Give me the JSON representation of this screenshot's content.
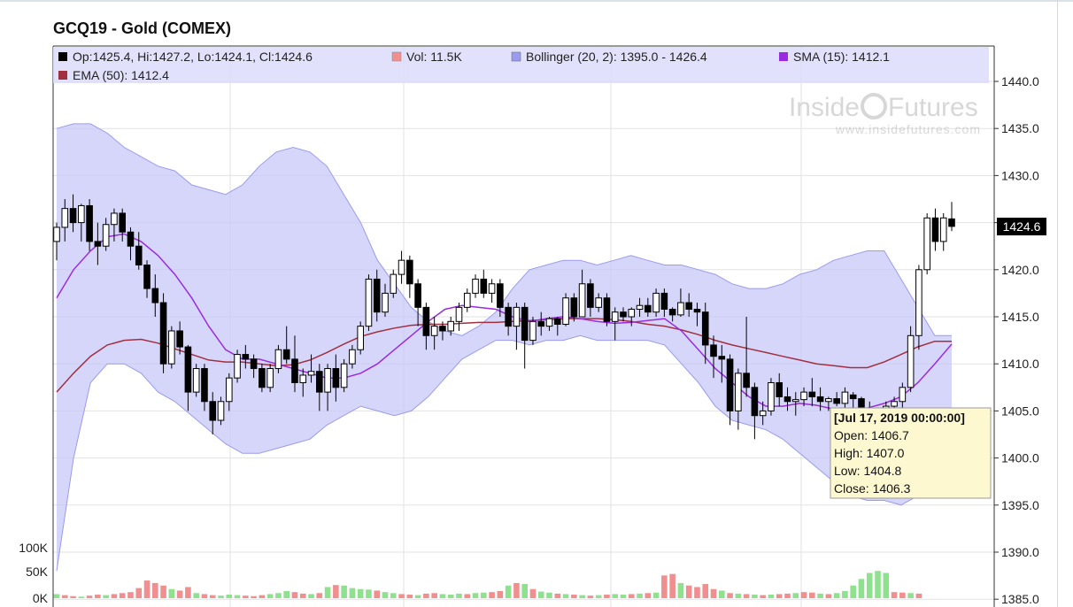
{
  "title": "GCQ19 - Gold (COMEX)",
  "legend": {
    "ohlc": "Op:1425.4, Hi:1427.2, Lo:1424.1, Cl:1424.6",
    "vol": "Vol: 11.5K",
    "bollinger": "Bollinger (20, 2): 1395.0 - 1426.4",
    "sma": "SMA (15): 1412.1",
    "ema": "EMA (50): 1412.4"
  },
  "watermark": {
    "brand_left": "Inside",
    "brand_right": "Futures",
    "url": "www.insidefutures.com"
  },
  "last_price_label": "1424.6",
  "tooltip": {
    "date": "[Jul 17, 2019 00:00:00]",
    "open": "Open: 1406.7",
    "high": "High: 1407.0",
    "low": "Low: 1404.8",
    "close": "Close: 1406.3"
  },
  "volume_axis": [
    "100K",
    "50K",
    "0K"
  ],
  "colors": {
    "up_volume": "#8fe08f",
    "down_volume": "#f08f8f",
    "bollinger_fill": "#c8c8f8",
    "bollinger_line": "#9a9af0",
    "sma": "#9a2be0",
    "ema": "#a03040",
    "candle_outline": "#000000"
  },
  "chart_data": {
    "type": "candlestick",
    "y_axis": {
      "ticks": [
        1385,
        1390,
        1395,
        1400,
        1405,
        1410,
        1415,
        1420,
        1425,
        1430,
        1435,
        1440
      ],
      "ylim": [
        1385,
        1441
      ],
      "position": "right"
    },
    "grid": true,
    "candles": [
      [
        1423,
        1425,
        1421,
        1424.5
      ],
      [
        1424.5,
        1427.5,
        1423,
        1426.5
      ],
      [
        1426.5,
        1428,
        1424,
        1425
      ],
      [
        1425,
        1427,
        1423,
        1426.8
      ],
      [
        1426.8,
        1427.5,
        1422,
        1423
      ],
      [
        1423,
        1425,
        1420.5,
        1422.5
      ],
      [
        1422.5,
        1425.5,
        1422,
        1424.8
      ],
      [
        1424.8,
        1426.5,
        1423,
        1426
      ],
      [
        1426,
        1426.5,
        1423,
        1424
      ],
      [
        1424,
        1424.5,
        1421,
        1422.5
      ],
      [
        1422.5,
        1424,
        1420,
        1420.5
      ],
      [
        1420.5,
        1421,
        1417,
        1418
      ],
      [
        1418,
        1419.5,
        1415,
        1416.5
      ],
      [
        1416.5,
        1417.5,
        1409,
        1410
      ],
      [
        1410,
        1414,
        1409.5,
        1413.5
      ],
      [
        1413.5,
        1414.5,
        1411,
        1411.8
      ],
      [
        1411.8,
        1412,
        1405,
        1407
      ],
      [
        1407,
        1410,
        1406.5,
        1409.5
      ],
      [
        1409.5,
        1410,
        1405,
        1406
      ],
      [
        1406,
        1407,
        1402.5,
        1404
      ],
      [
        1404,
        1406.5,
        1403.5,
        1406
      ],
      [
        1406,
        1409,
        1405,
        1408.5
      ],
      [
        1408.5,
        1411.5,
        1408,
        1411
      ],
      [
        1411,
        1412,
        1409.5,
        1410.5
      ],
      [
        1410.5,
        1411,
        1408.5,
        1409.5
      ],
      [
        1409.5,
        1410,
        1407,
        1407.5
      ],
      [
        1407.5,
        1410,
        1407,
        1409.5
      ],
      [
        1409.5,
        1412,
        1409,
        1411.5
      ],
      [
        1411.5,
        1414,
        1410,
        1410.5
      ],
      [
        1410.5,
        1413,
        1407,
        1408
      ],
      [
        1408,
        1409.5,
        1406.5,
        1408.8
      ],
      [
        1408.8,
        1411,
        1408,
        1409.2
      ],
      [
        1409.2,
        1410,
        1405,
        1407
      ],
      [
        1407,
        1410,
        1405,
        1409.5
      ],
      [
        1409.5,
        1411,
        1406,
        1407.5
      ],
      [
        1407.5,
        1410.5,
        1407,
        1410
      ],
      [
        1410,
        1412,
        1409.5,
        1411.5
      ],
      [
        1411.5,
        1414.5,
        1411,
        1414
      ],
      [
        1414,
        1419.5,
        1413.5,
        1419
      ],
      [
        1419,
        1420,
        1414.5,
        1415.5
      ],
      [
        1415.5,
        1418.5,
        1415,
        1417.5
      ],
      [
        1417.5,
        1420,
        1417,
        1419.5
      ],
      [
        1419.5,
        1422,
        1418.5,
        1421
      ],
      [
        1421,
        1421.5,
        1417,
        1418.5
      ],
      [
        1418.5,
        1419,
        1414,
        1416
      ],
      [
        1416,
        1416.5,
        1411.5,
        1413
      ],
      [
        1413,
        1415,
        1411.5,
        1414
      ],
      [
        1414,
        1414.5,
        1412.5,
        1413.5
      ],
      [
        1413.5,
        1415,
        1413,
        1414.5
      ],
      [
        1414.5,
        1416.5,
        1413.5,
        1416
      ],
      [
        1416,
        1418,
        1415.5,
        1417.5
      ],
      [
        1417.5,
        1419.5,
        1417,
        1419
      ],
      [
        1419,
        1420,
        1417,
        1417.5
      ],
      [
        1417.5,
        1419,
        1416.5,
        1418.5
      ],
      [
        1418.5,
        1419,
        1415,
        1416
      ],
      [
        1416,
        1416.5,
        1413,
        1414
      ],
      [
        1414,
        1416.5,
        1411.5,
        1416
      ],
      [
        1416,
        1416.5,
        1409.5,
        1412.5
      ],
      [
        1412.5,
        1415,
        1412,
        1414.5
      ],
      [
        1414.5,
        1415.5,
        1413,
        1414
      ],
      [
        1414,
        1415,
        1413.5,
        1414.8
      ],
      [
        1414.8,
        1415,
        1413,
        1414.2
      ],
      [
        1414.2,
        1417.5,
        1414,
        1417
      ],
      [
        1417,
        1417.5,
        1414.5,
        1415
      ],
      [
        1415,
        1420,
        1415,
        1418.5
      ],
      [
        1418.5,
        1419,
        1415,
        1416
      ],
      [
        1416,
        1417.5,
        1415.5,
        1417
      ],
      [
        1417,
        1417.5,
        1414,
        1414.5
      ],
      [
        1414.5,
        1416,
        1412.5,
        1415.5
      ],
      [
        1415.5,
        1416,
        1414.5,
        1415
      ],
      [
        1415,
        1416,
        1414,
        1415.8
      ],
      [
        1415.8,
        1417,
        1415,
        1416.2
      ],
      [
        1416.2,
        1417,
        1415,
        1415.5
      ],
      [
        1415.5,
        1418,
        1415,
        1417.5
      ],
      [
        1417.5,
        1418,
        1415,
        1415.8
      ],
      [
        1415.8,
        1416,
        1414.5,
        1415.2
      ],
      [
        1415.2,
        1418,
        1415,
        1416.5
      ],
      [
        1416.5,
        1417.5,
        1415,
        1415.8
      ],
      [
        1415.8,
        1416.5,
        1414,
        1415.5
      ],
      [
        1415.5,
        1416.5,
        1410,
        1412
      ],
      [
        1412,
        1413,
        1408.5,
        1410.8
      ],
      [
        1410.8,
        1412,
        1408,
        1410.5
      ],
      [
        1410.5,
        1411,
        1403.5,
        1405
      ],
      [
        1405,
        1409.5,
        1403,
        1409
      ],
      [
        1409,
        1415,
        1406.5,
        1407.5
      ],
      [
        1407.5,
        1408,
        1402,
        1404.5
      ],
      [
        1404.5,
        1406,
        1403.5,
        1405
      ],
      [
        1405,
        1408.5,
        1404.5,
        1408
      ],
      [
        1408,
        1409,
        1405.5,
        1406.5
      ],
      [
        1406.5,
        1407.5,
        1405,
        1406
      ],
      [
        1406,
        1407,
        1404.5,
        1406.2
      ],
      [
        1406.2,
        1407.5,
        1405.5,
        1407
      ],
      [
        1407,
        1408.5,
        1405.5,
        1406.5
      ],
      [
        1406.5,
        1407.5,
        1405,
        1406
      ],
      [
        1406,
        1406.5,
        1405,
        1406.3
      ],
      [
        1406.3,
        1407,
        1405.5,
        1405.8
      ],
      [
        1405.8,
        1407.5,
        1405,
        1407
      ],
      [
        1406.7,
        1407,
        1404.8,
        1406.3
      ],
      [
        1406.3,
        1406.5,
        1404,
        1405
      ],
      [
        1405,
        1406,
        1403.5,
        1404.5
      ],
      [
        1404.5,
        1405,
        1402.5,
        1403.5
      ],
      [
        1403.5,
        1406,
        1403,
        1405.5
      ],
      [
        1405.5,
        1406.5,
        1404,
        1406
      ],
      [
        1406,
        1408,
        1405,
        1407.5
      ],
      [
        1407.5,
        1414,
        1407,
        1413
      ],
      [
        1413,
        1420.5,
        1411.5,
        1420
      ],
      [
        1420,
        1426,
        1419.5,
        1425.5
      ],
      [
        1425.5,
        1426.5,
        1422,
        1423
      ],
      [
        1423,
        1426,
        1422,
        1425.5
      ],
      [
        1425.4,
        1427.2,
        1424.1,
        1424.6
      ]
    ],
    "volume": [
      [
        "u",
        8
      ],
      [
        "d",
        6
      ],
      [
        "d",
        4
      ],
      [
        "u",
        3
      ],
      [
        "d",
        5
      ],
      [
        "d",
        7
      ],
      [
        "u",
        6
      ],
      [
        "d",
        8
      ],
      [
        "d",
        10
      ],
      [
        "d",
        12
      ],
      [
        "d",
        20
      ],
      [
        "d",
        35
      ],
      [
        "d",
        30
      ],
      [
        "d",
        25
      ],
      [
        "u",
        18
      ],
      [
        "d",
        15
      ],
      [
        "d",
        22
      ],
      [
        "u",
        10
      ],
      [
        "d",
        8
      ],
      [
        "d",
        6
      ],
      [
        "u",
        5
      ],
      [
        "u",
        7
      ],
      [
        "u",
        6
      ],
      [
        "d",
        5
      ],
      [
        "d",
        4
      ],
      [
        "d",
        6
      ],
      [
        "u",
        8
      ],
      [
        "u",
        10
      ],
      [
        "u",
        14
      ],
      [
        "d",
        12
      ],
      [
        "d",
        9
      ],
      [
        "u",
        8
      ],
      [
        "d",
        10
      ],
      [
        "u",
        22
      ],
      [
        "d",
        26
      ],
      [
        "u",
        25
      ],
      [
        "u",
        20
      ],
      [
        "u",
        18
      ],
      [
        "u",
        17
      ],
      [
        "d",
        15
      ],
      [
        "u",
        12
      ],
      [
        "u",
        10
      ],
      [
        "d",
        8
      ],
      [
        "d",
        7
      ],
      [
        "u",
        6
      ],
      [
        "d",
        9
      ],
      [
        "d",
        10
      ],
      [
        "u",
        8
      ],
      [
        "u",
        7
      ],
      [
        "u",
        9
      ],
      [
        "d",
        8
      ],
      [
        "u",
        10
      ],
      [
        "u",
        11
      ],
      [
        "d",
        12
      ],
      [
        "d",
        14
      ],
      [
        "u",
        25
      ],
      [
        "d",
        30
      ],
      [
        "u",
        28
      ],
      [
        "d",
        18
      ],
      [
        "u",
        13
      ],
      [
        "u",
        11
      ],
      [
        "d",
        9
      ],
      [
        "u",
        8
      ],
      [
        "d",
        7
      ],
      [
        "u",
        6
      ],
      [
        "d",
        5
      ],
      [
        "u",
        6
      ],
      [
        "d",
        7
      ],
      [
        "u",
        8
      ],
      [
        "u",
        7
      ],
      [
        "d",
        8
      ],
      [
        "u",
        9
      ],
      [
        "d",
        10
      ],
      [
        "u",
        11
      ],
      [
        "d",
        45
      ],
      [
        "d",
        48
      ],
      [
        "u",
        30
      ],
      [
        "d",
        25
      ],
      [
        "d",
        22
      ],
      [
        "d",
        28
      ],
      [
        "d",
        18
      ],
      [
        "u",
        15
      ],
      [
        "d",
        10
      ],
      [
        "u",
        9
      ],
      [
        "d",
        8
      ],
      [
        "u",
        7
      ],
      [
        "d",
        6
      ],
      [
        "u",
        7
      ],
      [
        "d",
        8
      ],
      [
        "d",
        9
      ],
      [
        "u",
        10
      ],
      [
        "d",
        12
      ],
      [
        "d",
        11
      ],
      [
        "u",
        9
      ],
      [
        "d",
        8
      ],
      [
        "u",
        10
      ],
      [
        "u",
        14
      ],
      [
        "u",
        25
      ],
      [
        "u",
        38
      ],
      [
        "u",
        50
      ],
      [
        "u",
        54
      ],
      [
        "u",
        50
      ],
      [
        "d",
        12
      ],
      [
        "d",
        11
      ],
      [
        "u",
        10
      ],
      [
        "d",
        9
      ]
    ],
    "bollinger_upper": [
      1435,
      1435.5,
      1435.5,
      1434.5,
      1433,
      1432,
      1431,
      1430.5,
      1429,
      1428.5,
      1428,
      1429,
      1431,
      1432.5,
      1433,
      1432.5,
      1431,
      1428,
      1425,
      1421,
      1418.5,
      1416,
      1414.5,
      1413.5,
      1413,
      1414,
      1415.5,
      1418,
      1420,
      1420.5,
      1421,
      1421,
      1420.5,
      1421,
      1421.5,
      1421,
      1420.5,
      1420.5,
      1420,
      1419.5,
      1418.5,
      1418,
      1418,
      1418.5,
      1419.5,
      1420,
      1421,
      1421.5,
      1422,
      1422,
      1419,
      1416,
      1413,
      1413
    ],
    "bollinger_lower": [
      1388,
      1400,
      1408,
      1410,
      1410,
      1409,
      1407,
      1406,
      1404.5,
      1403,
      1401.5,
      1400.5,
      1400.5,
      1401,
      1401.5,
      1402,
      1403.5,
      1404.5,
      1405.5,
      1405,
      1404.5,
      1405,
      1406.5,
      1408.5,
      1410.5,
      1411.5,
      1412.5,
      1412.5,
      1412,
      1412.5,
      1412.5,
      1413,
      1412.5,
      1412.5,
      1412.5,
      1412.5,
      1412,
      1410,
      1408,
      1405.5,
      1404,
      1403.5,
      1403,
      1402,
      1400.5,
      1399,
      1397.5,
      1396,
      1395.5,
      1395.5,
      1395,
      1396,
      1397,
      1398
    ],
    "sma": [
      1417,
      1420,
      1422,
      1423.5,
      1423.8,
      1423,
      1421.5,
      1419.5,
      1417,
      1414,
      1411.5,
      1410.5,
      1410.5,
      1410,
      1409.5,
      1409,
      1408.5,
      1408.5,
      1409,
      1410,
      1411.5,
      1413,
      1414.5,
      1415.8,
      1416.2,
      1416,
      1415.8,
      1415,
      1414.5,
      1414.8,
      1415,
      1414.8,
      1414.5,
      1414.3,
      1414.4,
      1414.6,
      1414.8,
      1413.5,
      1411.5,
      1409.5,
      1408,
      1406.5,
      1405.5,
      1405.5,
      1405.8,
      1405.6,
      1405.2,
      1405,
      1405.3,
      1405.8,
      1406.5,
      1408,
      1410,
      1412.1
    ],
    "ema": [
      1407,
      1409,
      1410.8,
      1412,
      1412.5,
      1412.6,
      1412.2,
      1411.6,
      1411,
      1410.4,
      1410.2,
      1410.2,
      1410,
      1409.8,
      1409.9,
      1410.4,
      1411.2,
      1412.1,
      1412.9,
      1413.4,
      1413.8,
      1414.1,
      1414.2,
      1414.2,
      1414.3,
      1414.4,
      1414.4,
      1414.5,
      1414.6,
      1414.7,
      1414.8,
      1414.8,
      1414.8,
      1414.7,
      1414.5,
      1414.2,
      1414,
      1413.6,
      1413.1,
      1412.5,
      1412,
      1411.6,
      1411.2,
      1410.8,
      1410.4,
      1410,
      1409.8,
      1409.6,
      1409.6,
      1410.2,
      1411,
      1411.8,
      1412.4,
      1412.4
    ]
  }
}
